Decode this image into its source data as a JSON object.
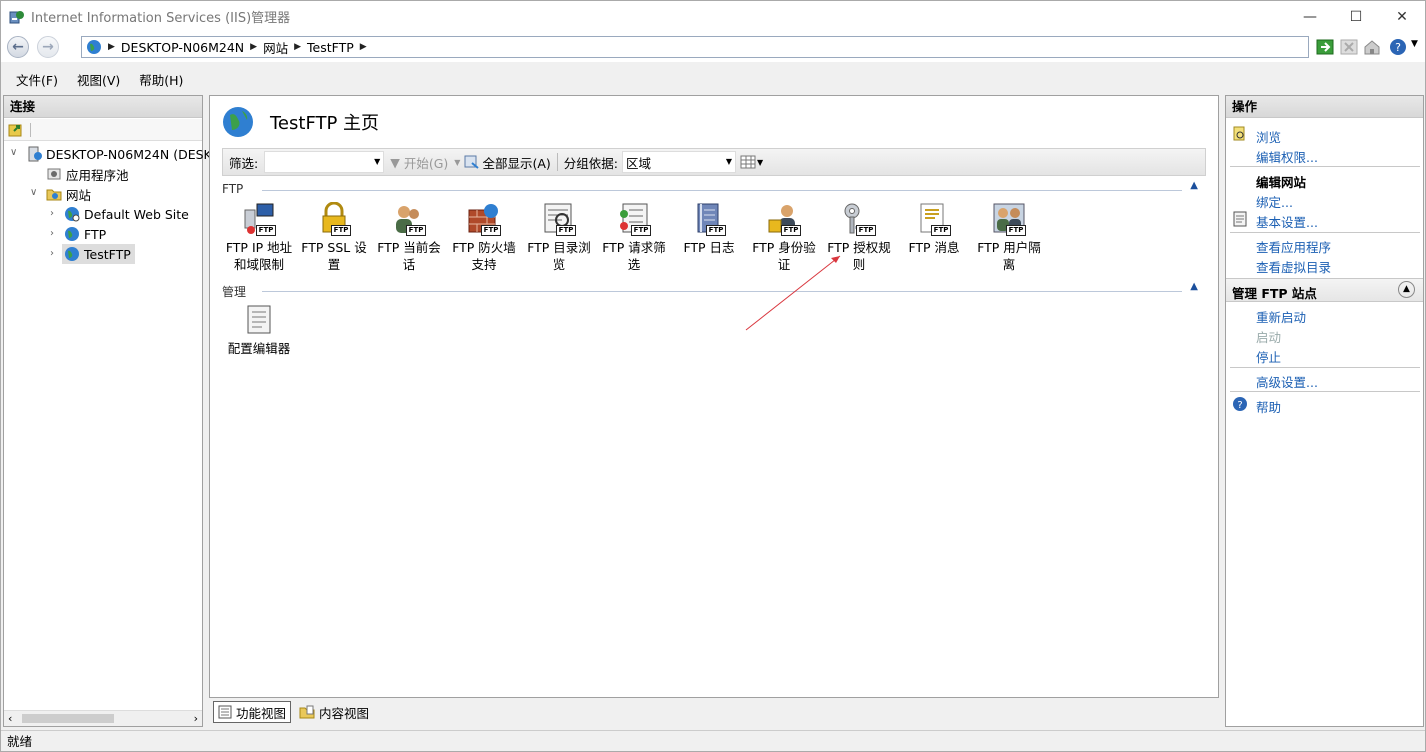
{
  "window": {
    "title": "Internet Information Services (IIS)管理器"
  },
  "address": {
    "crumbs": [
      "DESKTOP-N06M24N",
      "网站",
      "TestFTP"
    ]
  },
  "menu": [
    "文件(F)",
    "视图(V)",
    "帮助(H)"
  ],
  "connections": {
    "header": "连接",
    "tree": {
      "server": "DESKTOP-N06M24N (DESKTOP",
      "app_pools": "应用程序池",
      "sites": "网站",
      "site1": "Default Web Site",
      "site2": "FTP",
      "site3": "TestFTP"
    }
  },
  "center": {
    "title": "TestFTP 主页",
    "filter_label": "筛选:",
    "start_label": "开始(G)",
    "showall_label": "全部显示(A)",
    "group_label": "分组依据:",
    "group_value": "区域",
    "groups": [
      {
        "name": "FTP",
        "items": [
          {
            "l1": "FTP IP 地址",
            "l2": "和域限制",
            "icon": "ip-restriction-icon"
          },
          {
            "l1": "FTP SSL 设",
            "l2": "置",
            "icon": "ssl-lock-icon"
          },
          {
            "l1": "FTP 当前会",
            "l2": "话",
            "icon": "sessions-icon"
          },
          {
            "l1": "FTP 防火墙",
            "l2": "支持",
            "icon": "firewall-icon"
          },
          {
            "l1": "FTP 目录浏",
            "l2": "览",
            "icon": "directory-browsing-icon"
          },
          {
            "l1": "FTP 请求筛",
            "l2": "选",
            "icon": "request-filtering-icon"
          },
          {
            "l1": "FTP 日志",
            "l2": "",
            "icon": "logging-icon"
          },
          {
            "l1": "FTP 身份验",
            "l2": "证",
            "icon": "authentication-icon"
          },
          {
            "l1": "FTP 授权规",
            "l2": "则",
            "icon": "authorization-key-icon"
          },
          {
            "l1": "FTP 消息",
            "l2": "",
            "icon": "messages-icon"
          },
          {
            "l1": "FTP 用户隔",
            "l2": "离",
            "icon": "user-isolation-icon"
          }
        ]
      },
      {
        "name": "管理",
        "items": [
          {
            "l1": "配置编辑器",
            "l2": "",
            "icon": "config-editor-icon"
          }
        ]
      }
    ]
  },
  "actions": {
    "header": "操作",
    "browse": "浏览",
    "edit_perms": "编辑权限...",
    "edit_site_hd": "编辑网站",
    "bindings": "绑定...",
    "basic_settings": "基本设置...",
    "view_apps": "查看应用程序",
    "view_vdirs": "查看虚拟目录",
    "manage_hd": "管理 FTP 站点",
    "restart": "重新启动",
    "start": "启动",
    "stop": "停止",
    "advanced": "高级设置...",
    "help": "帮助"
  },
  "tabs": {
    "features": "功能视图",
    "content": "内容视图"
  },
  "status": "就绪",
  "colors": {
    "link": "#1b5fb3",
    "annotation_arrow": "#d9363e"
  }
}
